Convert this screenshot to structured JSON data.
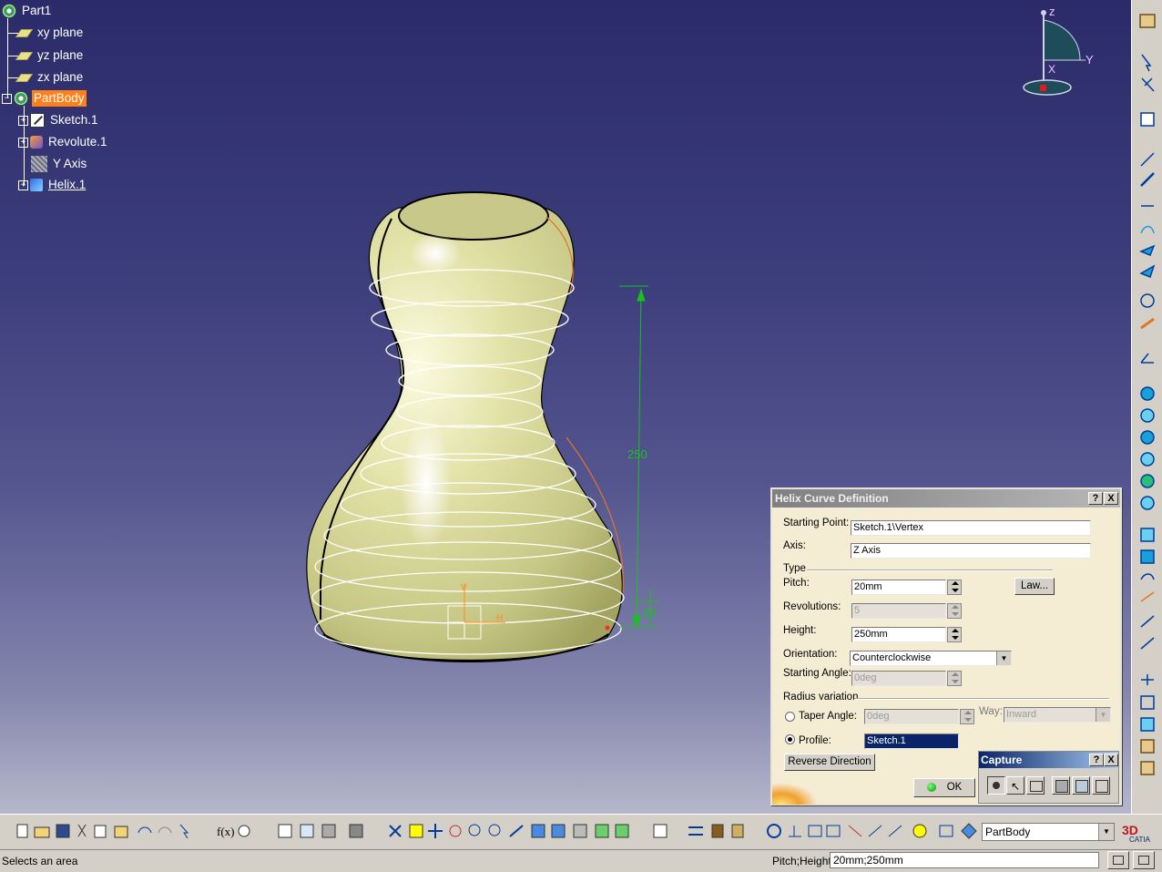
{
  "tree": {
    "root": "Part1",
    "planes": [
      "xy plane",
      "yz plane",
      "zx plane"
    ],
    "body": "PartBody",
    "children": [
      "Sketch.1",
      "Revolute.1",
      "Y Axis",
      "Helix.1"
    ]
  },
  "compass": {
    "z": "z",
    "y": "Y",
    "x": "X"
  },
  "dimensions": {
    "height": "250",
    "pitch": "20"
  },
  "dialog": {
    "title": "Helix Curve Definition",
    "help_btn": "?",
    "close_btn": "X",
    "starting_point_label": "Starting Point:",
    "starting_point_value": "Sketch.1\\Vertex",
    "axis_label": "Axis:",
    "axis_value": "Z Axis",
    "type_label": "Type",
    "pitch_label": "Pitch:",
    "pitch_value": "20mm",
    "law_btn": "Law...",
    "revolutions_label": "Revolutions:",
    "revolutions_value": "5",
    "height_label": "Height:",
    "height_value": "250mm",
    "orientation_label": "Orientation:",
    "orientation_value": "Counterclockwise",
    "starting_angle_label": "Starting Angle:",
    "starting_angle_value": "0deg",
    "radius_variation_label": "Radius variation",
    "taper_angle_label": "Taper Angle:",
    "taper_angle_value": "0deg",
    "way_label": "Way:",
    "way_value": "Inward",
    "profile_label": "Profile:",
    "profile_value": "Sketch.1",
    "reverse_btn": "Reverse Direction",
    "ok_btn": "OK"
  },
  "capture": {
    "title": "Capture",
    "help_btn": "?",
    "close_btn": "X"
  },
  "toolbar": {
    "current_body": "PartBody"
  },
  "status": {
    "message": "Selects an area",
    "param_label": "Pitch;Height",
    "param_value": "20mm;250mm"
  },
  "colors": {
    "selection": "#ff7f1a",
    "body": "#d8d89a",
    "dimension": "#19c219",
    "dialog_bg": "#f5ecd4"
  }
}
